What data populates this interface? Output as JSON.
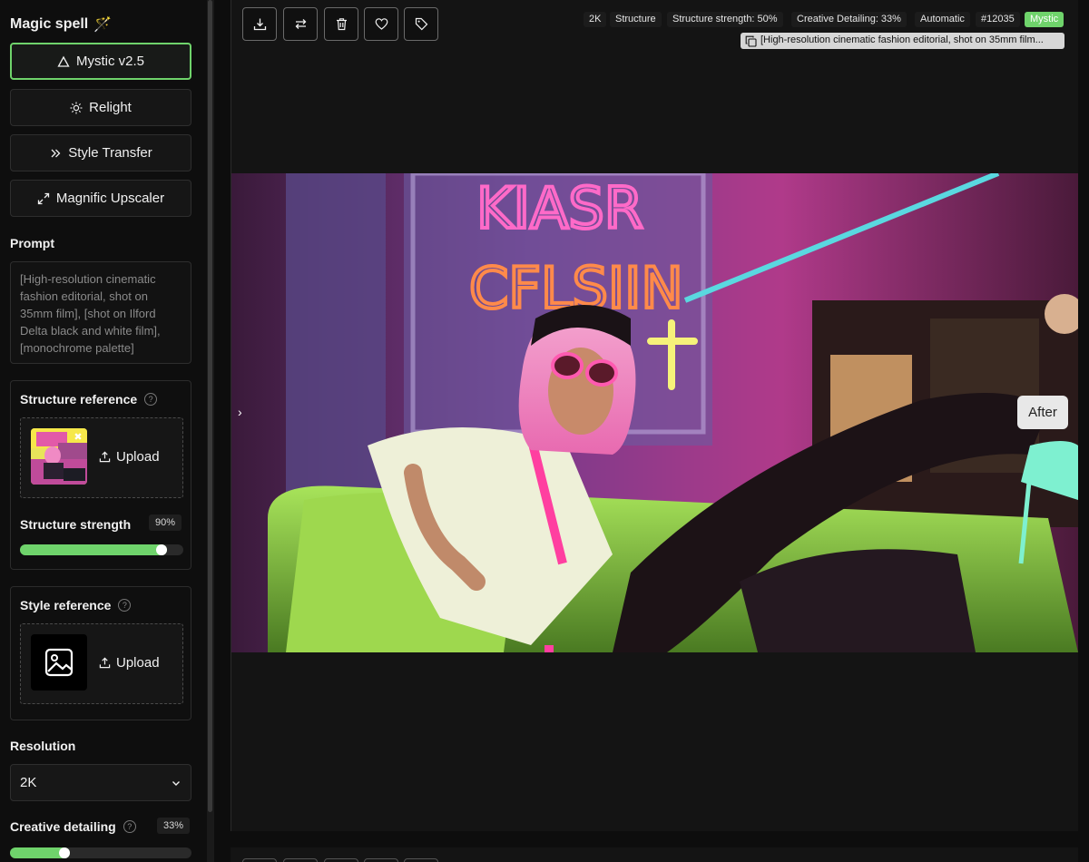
{
  "sidebar": {
    "title": "Magic spell",
    "modes": [
      {
        "label": "Mystic v2.5",
        "icon": "triangle-icon"
      },
      {
        "label": "Relight",
        "icon": "sun-icon"
      },
      {
        "label": "Style Transfer",
        "icon": "double-chevron-icon"
      },
      {
        "label": "Magnific Upscaler",
        "icon": "expand-icon"
      }
    ],
    "prompt_label": "Prompt",
    "prompt_value": "[High-resolution cinematic fashion editorial, shot on 35mm film], [shot on Ilford Delta black and white film], [monochrome palette]",
    "structure_reference": {
      "label": "Structure reference",
      "upload_label": "Upload",
      "strength_label": "Structure strength",
      "strength_value": "90%",
      "strength_fraction": 0.9
    },
    "style_reference": {
      "label": "Style reference",
      "upload_label": "Upload"
    },
    "resolution": {
      "label": "Resolution",
      "value": "2K"
    },
    "creative_detailing": {
      "label": "Creative detailing",
      "value": "33%",
      "fraction": 0.33
    }
  },
  "toolbar": {
    "buttons": [
      "download-icon",
      "swap-icon",
      "trash-icon",
      "heart-icon",
      "tag-icon"
    ]
  },
  "tags": {
    "resolution": "2K",
    "mode": "Structure",
    "structure_strength": "Structure strength: 50%",
    "creative_detailing": "Creative Detailing: 33%",
    "engine": "Automatic",
    "id": "#12035",
    "model": "Mystic",
    "prompt": "[High-resolution cinematic fashion editorial, shot on 35mm film..."
  },
  "preview": {
    "after_label": "After",
    "neon_line1": "KIASR",
    "neon_line2": "CFLSIIN"
  },
  "colors": {
    "accent": "#6fd36b",
    "neon_pink": "#ff3fb0",
    "couch_green": "#8fd14f"
  }
}
